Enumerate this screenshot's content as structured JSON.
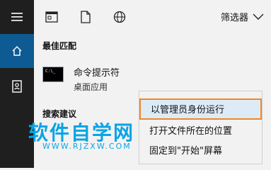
{
  "topbar": {
    "filter_label": "筛选器"
  },
  "sections": {
    "best_match": "最佳匹配",
    "search_suggestions": "搜索建议"
  },
  "result": {
    "title": "命令提示符",
    "subtitle": "桌面应用",
    "icon_text": "C:\\_"
  },
  "context_menu": {
    "items": [
      "以管理员身份运行",
      "打开文件所在的位置",
      "固定到\"开始\"屏幕"
    ]
  },
  "watermark": {
    "title": "软件自学网",
    "url": "WWW.RJZXW.COM"
  },
  "colors": {
    "rail": "#1f1f1f",
    "rail_active": "#0e5a93",
    "highlight_border": "#f0862b",
    "highlight_fill": "#ddebf7",
    "watermark": "#0aa4e6"
  }
}
